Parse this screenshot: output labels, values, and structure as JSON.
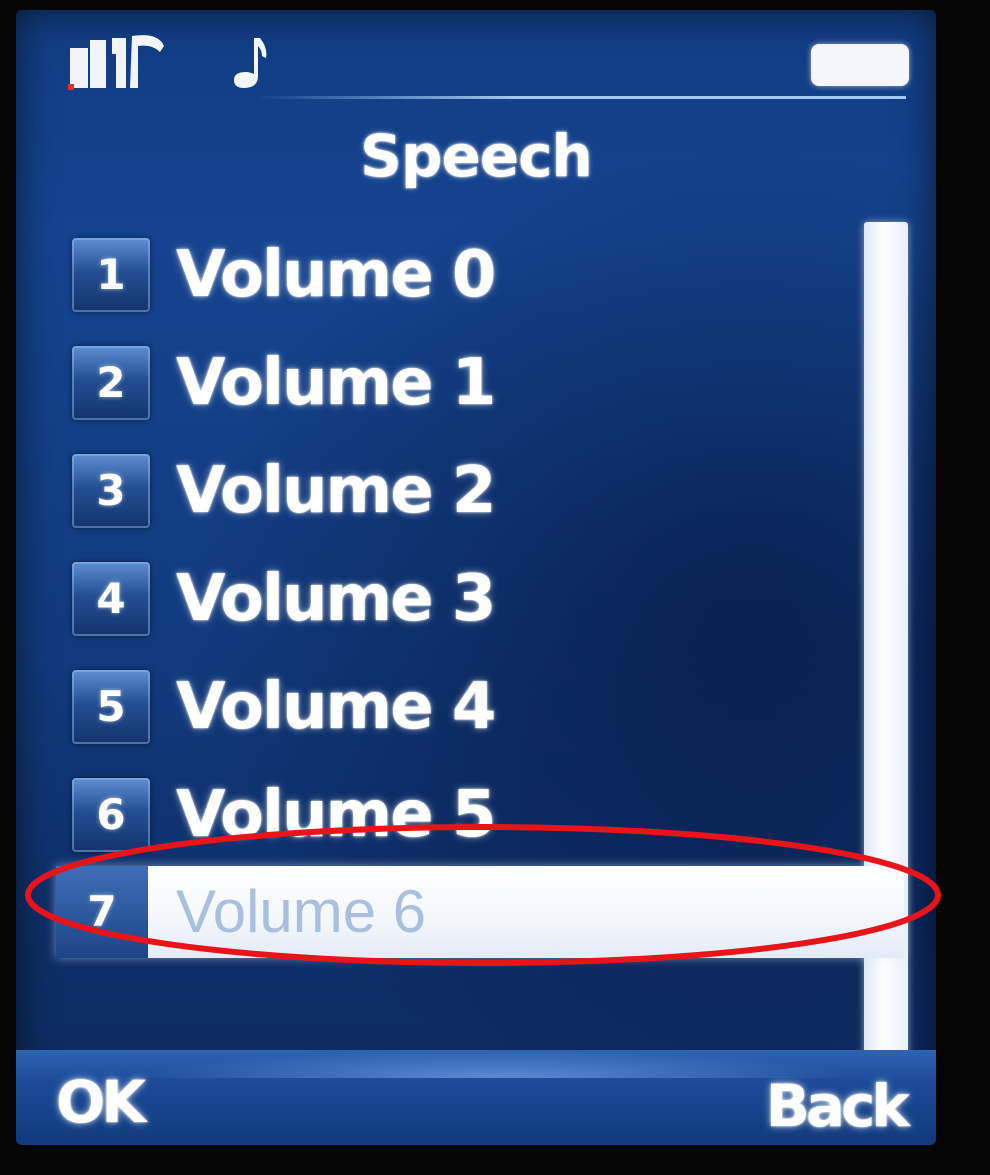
{
  "status_bar": {
    "signal_icon": "signal-strength-icon",
    "ringer_icon": "music-note-icon",
    "battery_icon": "battery-icon"
  },
  "title": "Speech",
  "menu": {
    "items": [
      {
        "number": "1",
        "label": "Volume 0",
        "selected": false
      },
      {
        "number": "2",
        "label": "Volume 1",
        "selected": false
      },
      {
        "number": "3",
        "label": "Volume 2",
        "selected": false
      },
      {
        "number": "4",
        "label": "Volume 3",
        "selected": false
      },
      {
        "number": "5",
        "label": "Volume 4",
        "selected": false
      },
      {
        "number": "6",
        "label": "Volume 5",
        "selected": false
      },
      {
        "number": "7",
        "label": "Volume 6",
        "selected": true
      }
    ]
  },
  "softkeys": {
    "left": "OK",
    "right": "Back"
  },
  "colors": {
    "screen_background": "#15438e",
    "highlight": "#ffffff",
    "selected_text": "#a9bfde",
    "annotation": "#e8141a"
  }
}
